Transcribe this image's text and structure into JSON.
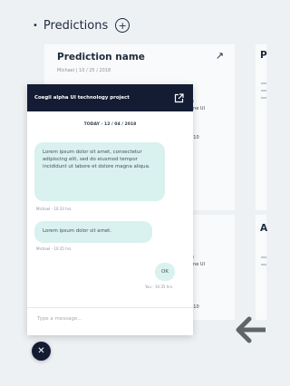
{
  "section": {
    "title": "Predictions",
    "add_symbol": "+"
  },
  "cards": [
    {
      "title": "Prediction name",
      "meta": "Michael  |  10 / 25 / 2018",
      "peek_1": "is",
      "peek_2": "one UI",
      "peek_3": "| 10"
    },
    {
      "peek_1": "is",
      "peek_2": "one UI",
      "peek_3": "| 10"
    }
  ],
  "right_edge": {
    "title_letter": "P",
    "second_letter": "A"
  },
  "chat": {
    "title": "Coegil alpha UI technology project",
    "date": "TODAY - 12 / 04 / 2018",
    "messages": [
      {
        "text": "Lorem ipsum dolor sit amet, consectetur adipiscing elit, sed do eiusmod tempor incididunt ut labore et dolore magna aliqua.",
        "meta": "Michael - 10:33 hrs."
      },
      {
        "text": "Lorem ipsum dolor sit amet.",
        "meta": "Michael - 10:35 hrs."
      },
      {
        "text": "OK",
        "meta": "You - 10:35 hrs."
      }
    ],
    "input_placeholder": "Type a message..."
  },
  "colors": {
    "header_bg": "#131c33",
    "bubble_bg": "#d9f1ef",
    "page_bg": "#eef1f4"
  },
  "icons": {
    "popout": "external-link-icon",
    "close": "close-icon",
    "back": "arrow-left-icon",
    "trend": "trend-up-icon"
  }
}
